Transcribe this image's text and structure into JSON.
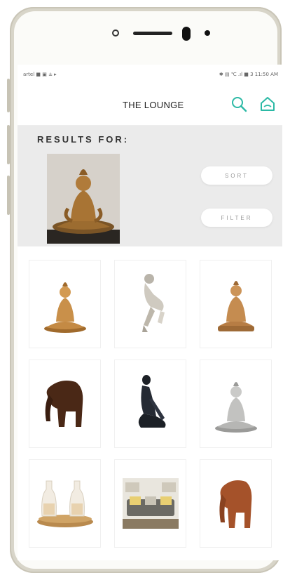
{
  "status_bar": {
    "left": "artel ■ ▣ ± ▸",
    "right": "✱ ▤ ℃  .ıl ■ 3 11:50 AM"
  },
  "app": {
    "title": "THE LOUNGE"
  },
  "results": {
    "label": "RESULTS FOR:",
    "sort_label": "SORT",
    "filter_label": "FILTER"
  },
  "products": [
    {
      "name": "golden-buddha"
    },
    {
      "name": "silver-sitting-figure"
    },
    {
      "name": "bronze-buddha"
    },
    {
      "name": "wooden-elephant-dark"
    },
    {
      "name": "black-meditating-figure"
    },
    {
      "name": "silver-buddha"
    },
    {
      "name": "glass-bottles-on-tray"
    },
    {
      "name": "living-room-sofa"
    },
    {
      "name": "wooden-elephant-light"
    }
  ],
  "colors": {
    "accent": "#2bb9a5",
    "results_bg": "#ebebeb",
    "phone_frame": "#d8d5c9"
  }
}
